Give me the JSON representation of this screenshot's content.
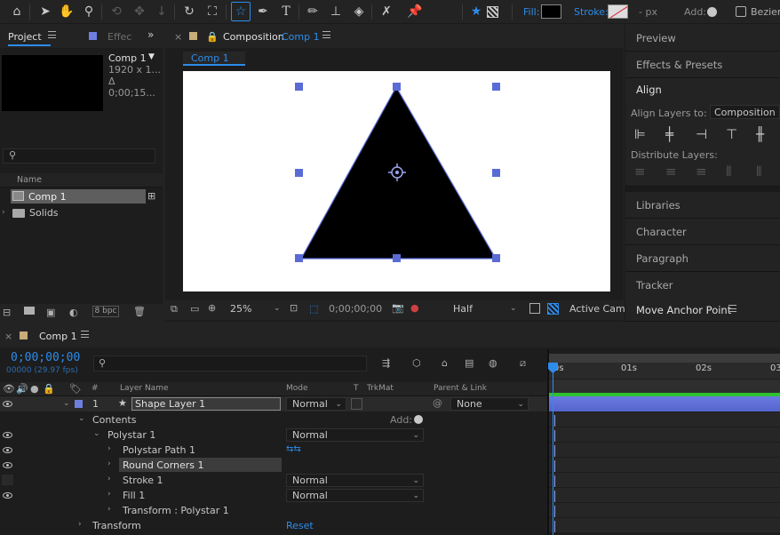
{
  "toolbar": {
    "fill_label": "Fill:",
    "stroke_label": "Stroke:",
    "stroke_width": "- px",
    "add_label": "Add:",
    "bezier_label": "Bezier",
    "colors": {
      "accent": "#2d8ceb",
      "fill_swatch": "#000000"
    }
  },
  "project": {
    "tab_label": "Project",
    "effects_tab": "Effec",
    "comp_name": "Comp 1",
    "comp_size": "1920 x 1...",
    "comp_duration": "Δ 0;00;15...",
    "search_placeholder": "",
    "column_name": "Name",
    "items": [
      {
        "label": "Comp 1",
        "type": "composition"
      },
      {
        "label": "Solids",
        "type": "folder"
      }
    ],
    "bpc": "8 bpc"
  },
  "composition": {
    "tab_prefix": "Composition",
    "tab_name": "Comp 1",
    "breadcrumb": "Comp 1",
    "zoom": "25%",
    "timecode": "0;00;00;00",
    "resolution": "Half",
    "camera": "Active Cam"
  },
  "right_panels": {
    "preview": "Preview",
    "effects_presets": "Effects & Presets",
    "align": "Align",
    "align_layers_to_label": "Align Layers to:",
    "align_layers_to_value": "Composition",
    "distribute_label": "Distribute Layers:",
    "libraries": "Libraries",
    "character": "Character",
    "paragraph": "Paragraph",
    "tracker": "Tracker",
    "move_anchor": "Move Anchor Point"
  },
  "timeline": {
    "tab_name": "Comp 1",
    "timecode": "0;00;00;00",
    "frame_info": "00000 (29.97 fps)",
    "search_placeholder": "",
    "headers": {
      "hash": "#",
      "layer_name": "Layer Name",
      "mode": "Mode",
      "t": "T",
      "trkmat": "TrkMat",
      "parent": "Parent & Link"
    },
    "ruler": [
      "0s",
      "01s",
      "02s",
      "03"
    ],
    "layer": {
      "number": "1",
      "name": "Shape Layer 1",
      "mode": "Normal",
      "parent": "None"
    },
    "contents_label": "Contents",
    "add_label": "Add:",
    "rows": [
      {
        "label": "Polystar 1",
        "mode": "Normal"
      },
      {
        "label": "Polystar Path 1",
        "mode": ""
      },
      {
        "label": "Round Corners 1",
        "mode": ""
      },
      {
        "label": "Stroke 1",
        "mode": "Normal"
      },
      {
        "label": "Fill 1",
        "mode": "Normal"
      },
      {
        "label": "Transform : Polystar 1",
        "mode": ""
      }
    ],
    "transform_label": "Transform",
    "reset_label": "Reset"
  }
}
